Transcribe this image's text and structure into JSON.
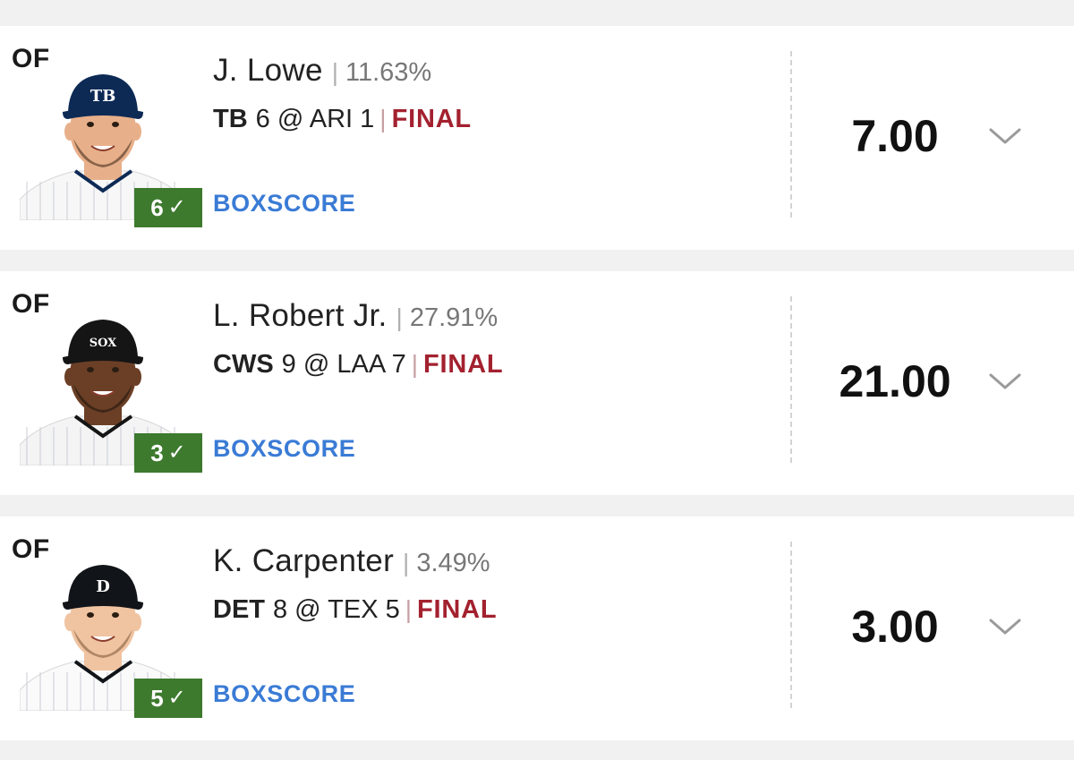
{
  "players": [
    {
      "position": "OF",
      "name": "J. Lowe",
      "ownership": "11.63%",
      "team": "TB",
      "game_rest": "6 @ ARI 1",
      "status": "FINAL",
      "boxscore_label": "BOXSCORE",
      "hits": "6",
      "points": "7.00",
      "cap_letters": "TB",
      "cap_color": "#0d2a55",
      "skin_color": "#e8b08a",
      "hair_color": "#3b2516",
      "jersey_color": "#f7f7f7"
    },
    {
      "position": "OF",
      "name": "L. Robert Jr.",
      "ownership": "27.91%",
      "team": "CWS",
      "game_rest": "9 @ LAA 7",
      "status": "FINAL",
      "boxscore_label": "BOXSCORE",
      "hits": "3",
      "points": "21.00",
      "cap_letters": "SOX",
      "cap_color": "#151515",
      "skin_color": "#6b3f26",
      "hair_color": "#1a1209",
      "jersey_color": "#f4f4f4"
    },
    {
      "position": "OF",
      "name": "K. Carpenter",
      "ownership": "3.49%",
      "team": "DET",
      "game_rest": "8 @ TEX 5",
      "status": "FINAL",
      "boxscore_label": "BOXSCORE",
      "hits": "5",
      "points": "3.00",
      "cap_letters": "D",
      "cap_color": "#111418",
      "skin_color": "#f0c3a1",
      "hair_color": "#7a5636",
      "jersey_color": "#fafafa"
    }
  ]
}
